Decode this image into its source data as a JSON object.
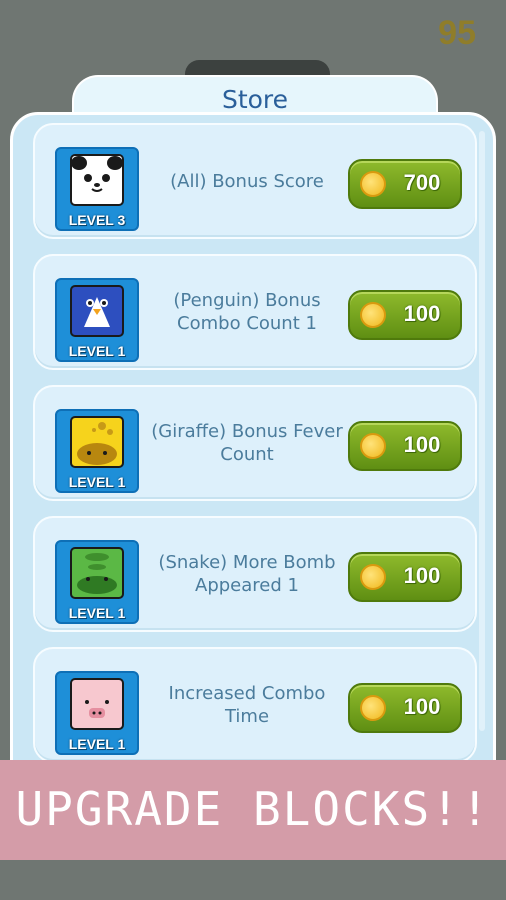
{
  "header": {
    "coin_count": "95"
  },
  "store": {
    "title": "Store"
  },
  "items": [
    {
      "animal": "panda",
      "icon": "panda-icon",
      "level": "LEVEL 3",
      "description": "(All) Bonus Score",
      "price": "700"
    },
    {
      "animal": "penguin",
      "icon": "penguin-icon",
      "level": "LEVEL 1",
      "description": "(Penguin) Bonus Combo Count 1",
      "price": "100"
    },
    {
      "animal": "giraffe",
      "icon": "giraffe-icon",
      "level": "LEVEL 1",
      "description": "(Giraffe) Bonus Fever Count",
      "price": "100"
    },
    {
      "animal": "snake",
      "icon": "snake-icon",
      "level": "LEVEL 1",
      "description": "(Snake) More Bomb Appeared 1",
      "price": "100"
    },
    {
      "animal": "pig",
      "icon": "pig-icon",
      "level": "LEVEL 1",
      "description": "Increased Combo Time",
      "price": "100"
    }
  ],
  "banner": {
    "text": "UPGRADE BLOCKS!!"
  },
  "colors": {
    "button": "#7aa81f",
    "panel": "#cbe7f5",
    "banner": "#d49ca8",
    "tile": "#1e8fd8"
  }
}
